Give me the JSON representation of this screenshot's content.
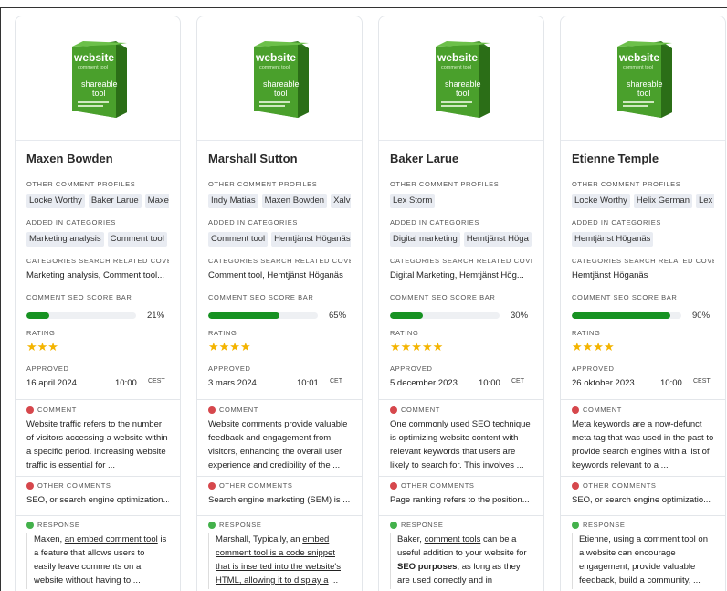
{
  "labels": {
    "other_profiles": "OTHER COMMENT PROFILES",
    "added_categories": "ADDED IN CATEGORIES",
    "categories_search": "CATEGORIES SEARCH RELATED COVERED...",
    "seo_bar": "COMMENT SEO SCORE BAR",
    "rating": "RATING",
    "approved": "APPROVED",
    "comment": "COMMENT",
    "other_comments": "OTHER COMMENTS",
    "response": "RESPONSE"
  },
  "product_box": {
    "title": "website",
    "subtitle": "comment tool",
    "line1": "shareable",
    "line2": "tool",
    "box_color": "#3d8f25"
  },
  "colors": {
    "bar": "#179222",
    "star": "#f4b400",
    "comment_dot": "#d6474c",
    "response_dot": "#43b14b"
  },
  "cards": [
    {
      "name": "Maxen Bowden",
      "profiles": [
        "Locke Worthy",
        "Baker Larue",
        "Maxen"
      ],
      "categories": [
        "Marketing analysis",
        "Comment tool"
      ],
      "search": "Marketing analysis, Comment tool...",
      "seo_score": 21,
      "seo_label": "21%",
      "stars": "★★★",
      "date": "16 april 2024",
      "time": "10:00",
      "tz": "CEST",
      "comment": "Website traffic refers to the number of visitors accessing a website within a specific period. Increasing website traffic is essential for ...",
      "other_comment": "SEO, or search engine optimization...",
      "response_parts": [
        {
          "t": "Maxen, ",
          "s": ""
        },
        {
          "t": "an embed comment tool",
          "s": "u"
        },
        {
          "t": " is a feature that allows users to easily leave comments on a website without having to ...",
          "s": ""
        }
      ]
    },
    {
      "name": "Marshall Sutton",
      "profiles": [
        "Indy Matias",
        "Maxen Bowden",
        "Xalv"
      ],
      "categories": [
        "Comment tool",
        "Hemtjänst Höganäs"
      ],
      "search": "Comment tool, Hemtjänst Höganäs",
      "seo_score": 65,
      "seo_label": "65%",
      "stars": "★★★★",
      "date": "3 mars 2024",
      "time": "10:01",
      "tz": "CET",
      "comment": "Website comments provide valuable feedback and engagement from visitors, enhancing the overall user experience and credibility of the ...",
      "other_comment": "Search engine marketing (SEM) is ...",
      "response_parts": [
        {
          "t": "Marshall, Typically, an ",
          "s": ""
        },
        {
          "t": "embed comment tool is a code snippet that is inserted into the website's HTML, allowing it to display a",
          "s": "u"
        },
        {
          "t": " ...",
          "s": ""
        }
      ]
    },
    {
      "name": "Baker Larue",
      "profiles": [
        "Lex Storm"
      ],
      "categories": [
        "Digital marketing",
        "Hemtjänst Höga"
      ],
      "search": "Digital Marketing, Hemtjänst Hög...",
      "seo_score": 30,
      "seo_label": "30%",
      "stars": "★★★★★",
      "date": "5 december 2023",
      "time": "10:00",
      "tz": "CET",
      "comment": "One commonly used SEO technique is optimizing website content with relevant keywords that users are likely to search for. This involves ...",
      "other_comment": "Page ranking refers to the position...",
      "response_parts": [
        {
          "t": "Baker, ",
          "s": ""
        },
        {
          "t": "comment tools",
          "s": "u"
        },
        {
          "t": " can be a useful addition to your website for ",
          "s": ""
        },
        {
          "t": "SEO purposes",
          "s": "b"
        },
        {
          "t": ", as long as they are used correctly and in moderatio...",
          "s": ""
        }
      ]
    },
    {
      "name": "Etienne Temple",
      "profiles": [
        "Locke Worthy",
        "Helix German",
        "Lex S"
      ],
      "categories": [
        "Hemtjänst Höganäs"
      ],
      "search": "Hemtjänst Höganäs",
      "seo_score": 90,
      "seo_label": "90%",
      "stars": "★★★★",
      "date": "26 oktober 2023",
      "time": "10:00",
      "tz": "CEST",
      "comment": "Meta keywords are a now-defunct meta tag that was used in the past to provide search engines with a list of keywords relevant to a ...",
      "other_comment": "SEO, or search engine optimizatio...",
      "response_parts": [
        {
          "t": "Etienne, using a comment tool on a website can encourage engagement, provide valuable feedback, build a community, ...",
          "s": ""
        }
      ]
    }
  ]
}
